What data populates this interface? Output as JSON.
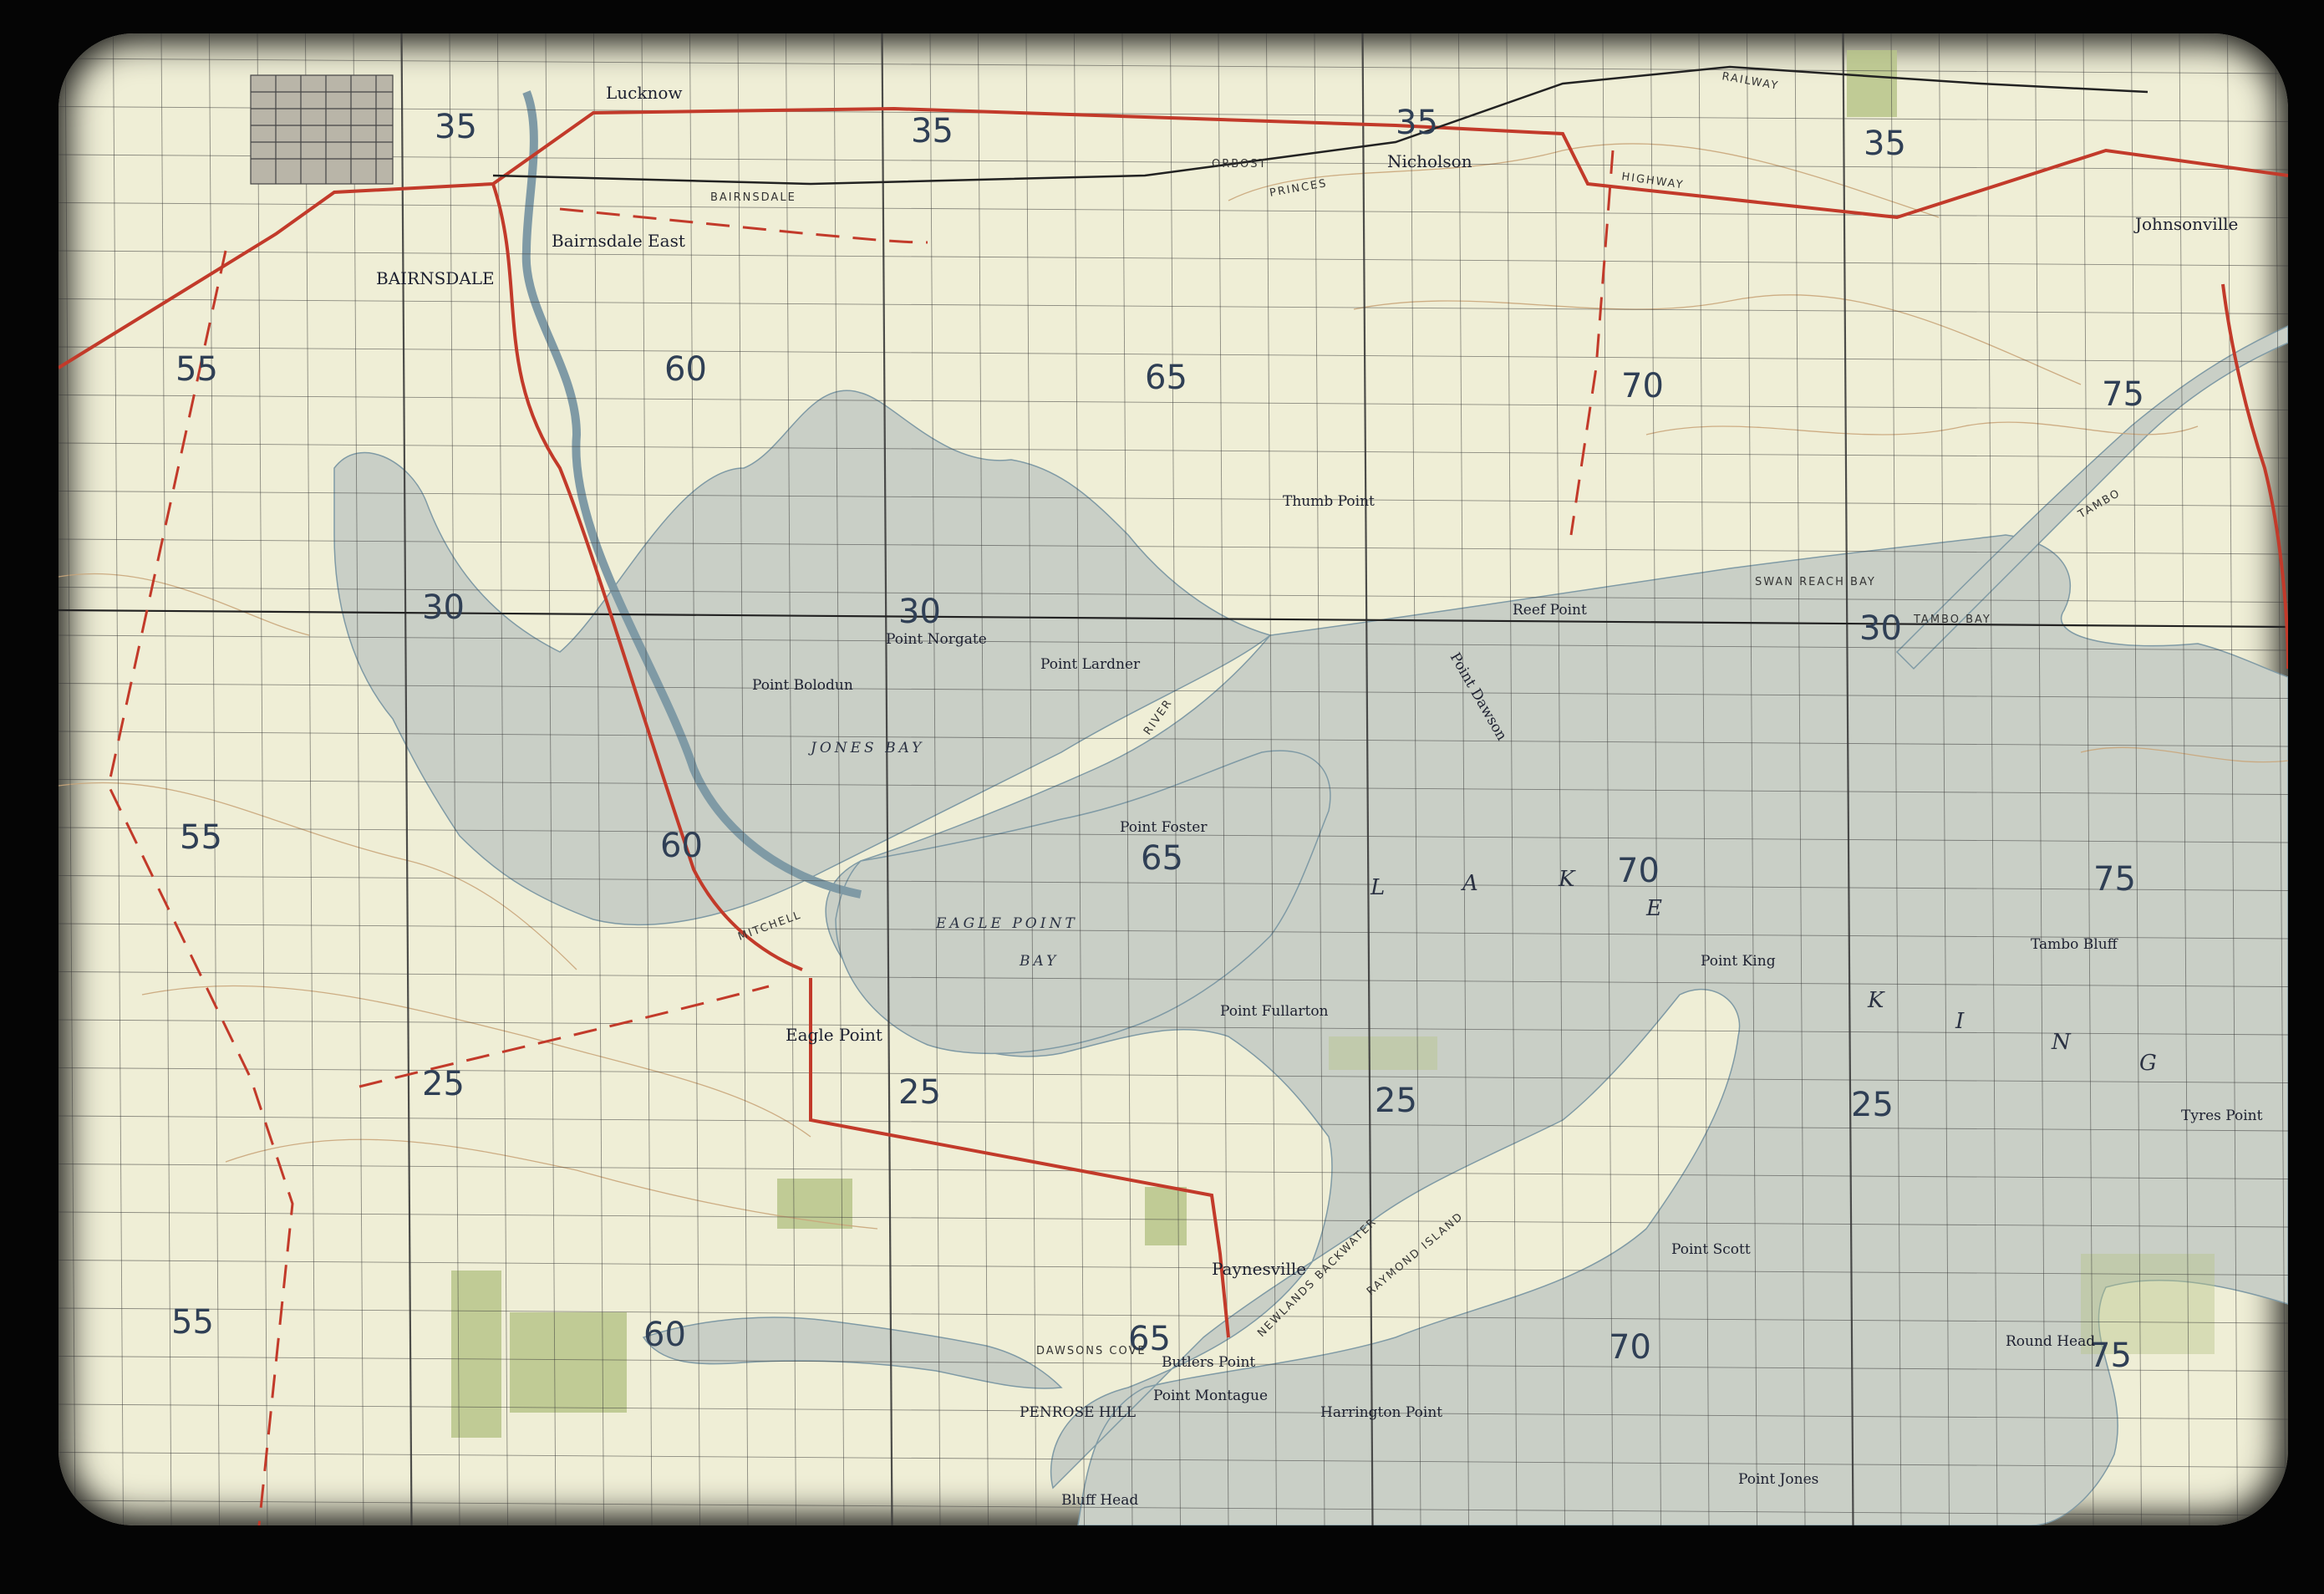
{
  "map": {
    "grid_labels": {
      "eastings_top": [
        "35",
        "35",
        "35",
        "35"
      ],
      "eastings_row1": [
        "55",
        "60",
        "65",
        "70",
        "75"
      ],
      "northing_30": [
        "30",
        "30",
        "30"
      ],
      "eastings_row2": [
        "55",
        "60",
        "65",
        "70",
        "75"
      ],
      "northing_25": [
        "25",
        "25",
        "25",
        "25"
      ],
      "eastings_row3": [
        "55",
        "60",
        "65",
        "70",
        "75"
      ]
    },
    "places": {
      "lucknow": "Lucknow",
      "bairnsdale": "BAIRNSDALE",
      "bairnsdale_east": "Bairnsdale East",
      "nicholson": "Nicholson",
      "johnsonville": "Johnsonville",
      "eagle_point": "Eagle Point",
      "paynesville": "Paynesville",
      "tambo_bluff": "Tambo Bluff",
      "thumb_point": "Thumb Point",
      "reef_point": "Reef Point",
      "point_dawson": "Point Dawson",
      "point_norgate": "Point Norgate",
      "point_lardner": "Point Lardner",
      "point_bolodun": "Point Bolodun",
      "point_foster": "Point Foster",
      "point_king": "Point King",
      "point_fullarton": "Point Fullarton",
      "point_scott": "Point Scott",
      "tyres_point": "Tyres Point",
      "round_head": "Round Head",
      "point_jones": "Point Jones",
      "butlers_point": "Butlers Point",
      "point_montague": "Point Montague",
      "harrington_point": "Harrington Point",
      "bluff_head": "Bluff Head",
      "penrose_hill": "PENROSE HILL",
      "dawsons_cove": "DAWSONS COVE"
    },
    "water": {
      "jones_bay": "JONES BAY",
      "eagle_point_bay": "EAGLE POINT",
      "eagle_point_bay_2": "BAY",
      "swan_reach_bay": "SWAN REACH BAY",
      "tambo_bay": "TAMBO BAY",
      "mitchell_river": "MITCHELL",
      "river": "RIVER",
      "lake_letters": [
        "L",
        "A",
        "K",
        "E",
        "K",
        "I",
        "N",
        "G"
      ],
      "newlands_backwater": "NEWLANDS BACKWATER",
      "raymond_island": "RAYMOND ISLAND",
      "tambo": "TAMBO"
    },
    "roads": {
      "princes": "PRINCES",
      "highway": "HIGHWAY",
      "orbost": "ORBOST",
      "bairnsdale_rail": "BAIRNSDALE",
      "railway": "RAILWAY"
    },
    "colors": {
      "land": "#efeed6",
      "water": "#c9cfc6",
      "grid": "#3a3a3a",
      "road_red": "#c23a2a",
      "contour": "#c9a57a",
      "vegetation": "#b7c48a"
    }
  }
}
